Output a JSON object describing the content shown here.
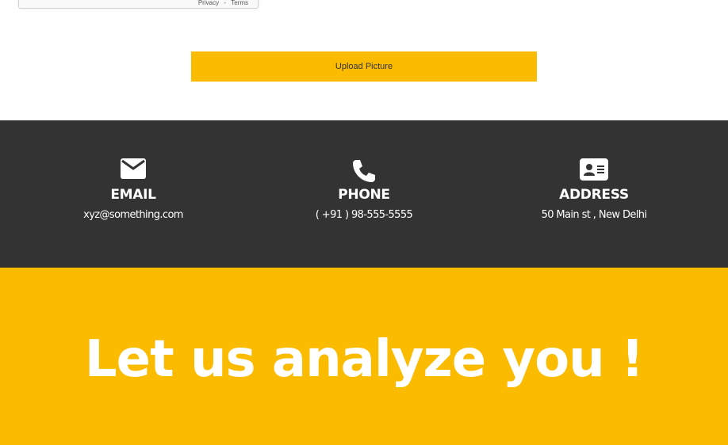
{
  "recaptcha": {
    "privacy_label": "Privacy",
    "separator": "-",
    "terms_label": "Terms"
  },
  "upload": {
    "button_label": "Upload Picture"
  },
  "contact": {
    "email": {
      "icon": "envelope-icon",
      "title": "EMAIL",
      "value": "xyz@something.com"
    },
    "phone": {
      "icon": "phone-icon",
      "title": "PHONE",
      "value": "( +91 ) 98-555-5555"
    },
    "address": {
      "icon": "address-card-icon",
      "title": "ADDRESS",
      "value": "50 Main st , New Delhi"
    }
  },
  "hero": {
    "title": "Let us analyze you !"
  },
  "colors": {
    "accent": "#fbbb00",
    "dark_band": "#333333",
    "text_light": "#ffffff"
  }
}
